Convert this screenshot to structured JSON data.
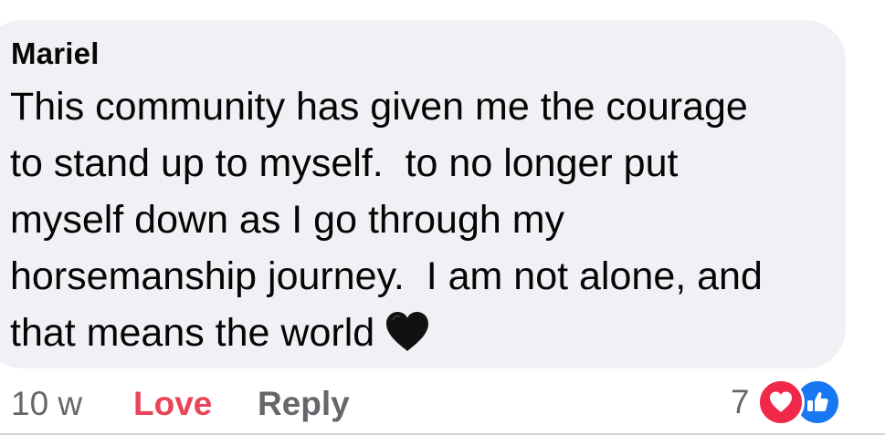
{
  "comment": {
    "author": "Mariel",
    "lines": [
      "This community has given me the courage",
      "to stand up to myself.  to no longer put",
      "myself down as I go through my",
      "horsemanship journey.  I am not alone, and",
      "that means the world"
    ],
    "emoji": "black-heart-emoji"
  },
  "footer": {
    "time": "10 w",
    "love_label": "Love",
    "reply_label": "Reply",
    "reaction_count": "7",
    "reaction_icons": [
      "love-icon",
      "like-icon"
    ]
  },
  "colors": {
    "bubble_bg": "#eff1f4",
    "love_active": "#e9445a",
    "muted": "#65676b",
    "like_blue": "#1877f2",
    "love_red": "#f0284a"
  }
}
